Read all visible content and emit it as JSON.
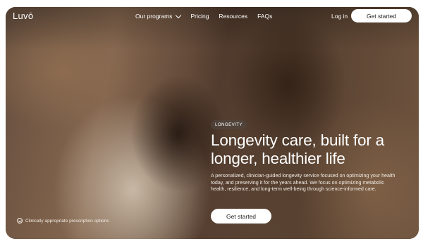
{
  "brand": {
    "logo": "Luvō"
  },
  "nav": {
    "items": [
      {
        "label": "Our programs",
        "has_dropdown": true
      },
      {
        "label": "Pricing"
      },
      {
        "label": "Resources"
      },
      {
        "label": "FAQs"
      }
    ],
    "login_label": "Log in",
    "cta_label": "Get started"
  },
  "hero": {
    "badge": "LONGEVITY",
    "headline": "Longevity care, built for a longer, healthier life",
    "description": "A personalized, clinician-guided longevity service focused on optimizing your health today, and preserving it for the years ahead. We focus on optimizing metabolic health, resilience, and long-term well-being through science-informed care.",
    "cta_label": "Get started",
    "note": "Clinically appropriate prescription options",
    "image_alt": "Smiling woman and man dancing with arms raised"
  },
  "colors": {
    "primary_button": "#ffffff",
    "text_on_image": "#ffffff"
  },
  "icons": {
    "nav_dropdown": "chevron-down-icon",
    "note": "check-circle-icon"
  }
}
